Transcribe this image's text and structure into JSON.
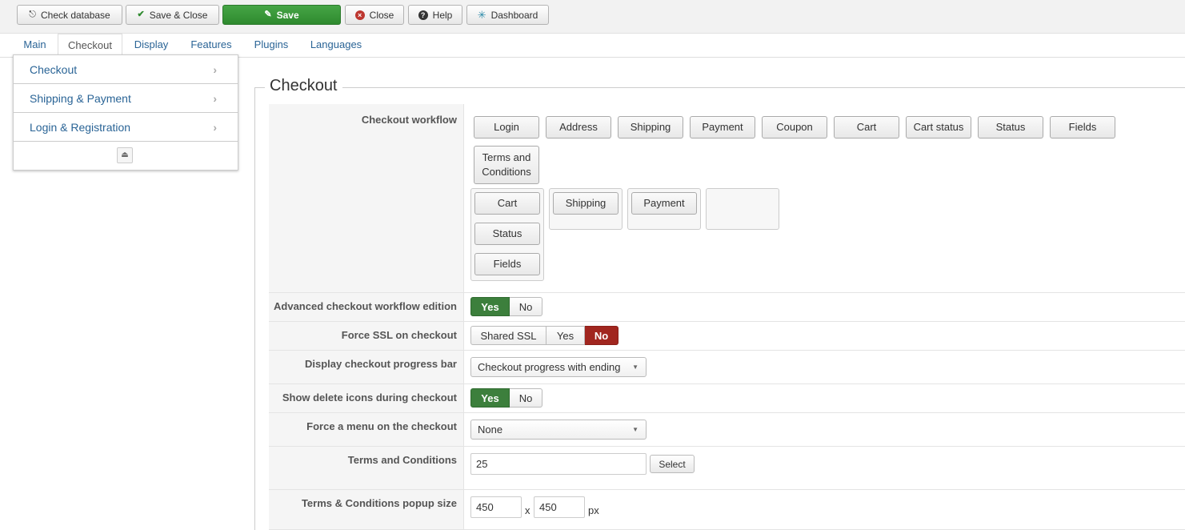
{
  "toolbar": {
    "check_database": "Check database",
    "save_close": "Save & Close",
    "save": "Save",
    "close": "Close",
    "help": "Help",
    "dashboard": "Dashboard"
  },
  "tabs": [
    "Main",
    "Checkout",
    "Display",
    "Features",
    "Plugins",
    "Languages"
  ],
  "active_tab": "Checkout",
  "sidemenu": {
    "items": [
      "Checkout",
      "Shipping & Payment",
      "Login & Registration"
    ]
  },
  "section": {
    "legend": "Checkout"
  },
  "params": {
    "workflow_label": "Checkout workflow",
    "workflow_palette": [
      "Login",
      "Address",
      "Shipping",
      "Payment",
      "Coupon",
      "Cart",
      "Cart status",
      "Status",
      "Fields",
      "Terms and Conditions"
    ],
    "workflow_step1": [
      "Cart",
      "Status",
      "Fields"
    ],
    "workflow_step2": [
      "Shipping"
    ],
    "workflow_step3": [
      "Payment"
    ],
    "advanced_label": "Advanced checkout workflow edition",
    "advanced_yes": "Yes",
    "advanced_no": "No",
    "ssl_label": "Force SSL on checkout",
    "ssl_shared": "Shared SSL",
    "ssl_yes": "Yes",
    "ssl_no": "No",
    "progress_label": "Display checkout progress bar",
    "progress_value": "Checkout progress with ending",
    "delete_icons_label": "Show delete icons during checkout",
    "delete_yes": "Yes",
    "delete_no": "No",
    "menu_label": "Force a menu on the checkout",
    "menu_value": "None",
    "terms_label": "Terms and Conditions",
    "terms_value": "25",
    "terms_select": "Select",
    "popup_label": "Terms & Conditions popup size",
    "popup_width": "450",
    "popup_x": "x",
    "popup_height": "450",
    "popup_unit": "px"
  },
  "colors": {
    "save_green": "#2f8a2f",
    "yes_green": "#3c7f3c",
    "no_red": "#a1261f",
    "link_blue": "#2a6496"
  }
}
